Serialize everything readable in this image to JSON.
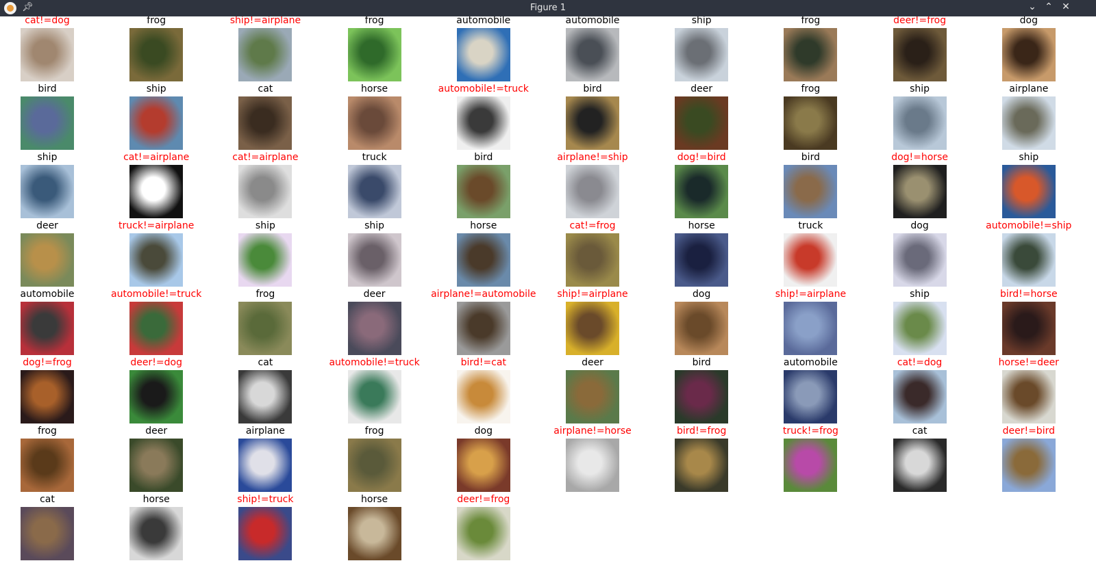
{
  "window": {
    "title": "Figure 1",
    "controls": [
      "minimize-icon",
      "maximize-icon",
      "close-icon"
    ]
  },
  "colors": {
    "correct": "#000000",
    "wrong": "#ff0000"
  },
  "labels": [
    "cat!=dog",
    "frog",
    "ship!=airplane",
    "frog",
    "automobile",
    "automobile",
    "ship",
    "frog",
    "deer!=frog",
    "dog",
    "bird",
    "ship",
    "cat",
    "horse",
    "automobile!=truck",
    "bird",
    "deer",
    "frog",
    "ship",
    "airplane",
    "ship",
    "cat!=airplane",
    "cat!=airplane",
    "truck",
    "bird",
    "airplane!=ship",
    "dog!=bird",
    "bird",
    "dog!=horse",
    "ship",
    "deer",
    "truck!=airplane",
    "ship",
    "ship",
    "horse",
    "cat!=frog",
    "horse",
    "truck",
    "dog",
    "automobile!=ship",
    "automobile",
    "automobile!=truck",
    "frog",
    "deer",
    "airplane!=automobile",
    "ship!=airplane",
    "dog",
    "ship!=airplane",
    "ship",
    "bird!=horse",
    "dog!=frog",
    "deer!=dog",
    "cat",
    "automobile!=truck",
    "bird!=cat",
    "deer",
    "bird",
    "automobile",
    "cat!=dog",
    "horse!=deer",
    "frog",
    "deer",
    "airplane",
    "frog",
    "dog",
    "airplane!=horse",
    "bird!=frog",
    "truck!=frog",
    "cat",
    "deer!=bird",
    "cat",
    "horse",
    "ship!=truck",
    "horse",
    "deer!=frog"
  ],
  "thumb_colors": [
    [
      "#d8cfc6",
      "#a08770"
    ],
    [
      "#7a6a3a",
      "#3a4a22"
    ],
    [
      "#9aa9b6",
      "#5f7a4a"
    ],
    [
      "#7cc35a",
      "#2f6a2a"
    ],
    [
      "#2f6fb6",
      "#d9d4c5"
    ],
    [
      "#b7b9bc",
      "#4a4f56"
    ],
    [
      "#c9d2db",
      "#6b6f75"
    ],
    [
      "#9a7a58",
      "#2f3a2a"
    ],
    [
      "#6e5a3a",
      "#2a2018"
    ],
    [
      "#c79a6a",
      "#3a2618"
    ],
    [
      "#4a8a6a",
      "#5a6a9a"
    ],
    [
      "#5e8ab0",
      "#b43c2e"
    ],
    [
      "#7a6048",
      "#3a2c20"
    ],
    [
      "#b98a6a",
      "#6a4a3a"
    ],
    [
      "#efefef",
      "#3a3a3a"
    ],
    [
      "#a6884e",
      "#222222"
    ],
    [
      "#6a3a22",
      "#3a4a22"
    ],
    [
      "#4a3a22",
      "#8a7a4a"
    ],
    [
      "#b8c8d8",
      "#6a7a8a"
    ],
    [
      "#d0dbe6",
      "#6a6a5a"
    ],
    [
      "#a8c0d8",
      "#3a5a7a"
    ],
    [
      "#111111",
      "#ffffff"
    ],
    [
      "#dedede",
      "#8a8a8a"
    ],
    [
      "#c0c8d8",
      "#3a4a6a"
    ],
    [
      "#7aa06a",
      "#6a4a2a"
    ],
    [
      "#cfd3d8",
      "#8a8a90"
    ],
    [
      "#5a8a4a",
      "#1a2a2a"
    ],
    [
      "#6a8ab8",
      "#8a6a4a"
    ],
    [
      "#1f1f1f",
      "#9a9070"
    ],
    [
      "#2a5a9a",
      "#d8582a"
    ],
    [
      "#7a8a5a",
      "#b8904a"
    ],
    [
      "#a8c8e8",
      "#4a4a3a"
    ],
    [
      "#e8d8f0",
      "#4a8a3a"
    ],
    [
      "#cfc6cc",
      "#6a6068"
    ],
    [
      "#6a8aaa",
      "#4a3a2a"
    ],
    [
      "#9a8a4a",
      "#6a5a3a"
    ],
    [
      "#4a5a8a",
      "#1a2040"
    ],
    [
      "#f0f0f0",
      "#c83a2a"
    ],
    [
      "#d8d8e8",
      "#6a6a7a"
    ],
    [
      "#c8d8e8",
      "#3a4a3a"
    ],
    [
      "#b8303a",
      "#3a3a3a"
    ],
    [
      "#c83a3a",
      "#3a6a3a"
    ],
    [
      "#8a8a5a",
      "#5a6a3a"
    ],
    [
      "#4a4a5a",
      "#8a6a7a"
    ],
    [
      "#9a9a9a",
      "#4a3a2a"
    ],
    [
      "#d8b02a",
      "#6a4a2a"
    ],
    [
      "#b8885a",
      "#6a4a2a"
    ],
    [
      "#5a6a9a",
      "#8aa0c8"
    ],
    [
      "#d8e0f0",
      "#6a8a4a"
    ],
    [
      "#6a3a2a",
      "#2a1a1a"
    ],
    [
      "#2a1a1a",
      "#a8602a"
    ],
    [
      "#3a8a3a",
      "#1a1a1a"
    ],
    [
      "#3a3a3a",
      "#d8d8d8"
    ],
    [
      "#e8e8e8",
      "#3a7a5a"
    ],
    [
      "#f8f4ee",
      "#c88a3a"
    ],
    [
      "#5a7a4a",
      "#8a6a3a"
    ],
    [
      "#2a3a2a",
      "#6a2a4a"
    ],
    [
      "#2a3a6a",
      "#8a9ab8"
    ],
    [
      "#a8c0d8",
      "#3a2a2a"
    ],
    [
      "#d8d8d0",
      "#6a4a2a"
    ],
    [
      "#a8683a",
      "#5a3a1a"
    ],
    [
      "#3a4a2a",
      "#8a7a5a"
    ],
    [
      "#2a4a9a",
      "#e0e0e8"
    ],
    [
      "#8a7a4a",
      "#5a5a3a"
    ],
    [
      "#7a3a2a",
      "#d8a04a"
    ],
    [
      "#a8a8a8",
      "#e8e8e8"
    ],
    [
      "#3a3a2a",
      "#a8884a"
    ],
    [
      "#5a8a3a",
      "#b84aa8"
    ],
    [
      "#2a2a2a",
      "#d8d8d8"
    ],
    [
      "#8aa8d8",
      "#8a6a3a"
    ],
    [
      "#5a4a5a",
      "#8a6a4a"
    ],
    [
      "#d8d8d8",
      "#3a3a3a"
    ],
    [
      "#3a4a8a",
      "#c82a2a"
    ],
    [
      "#6a4a2a",
      "#c8b89a"
    ],
    [
      "#d8d8c8",
      "#6a8a3a"
    ]
  ]
}
